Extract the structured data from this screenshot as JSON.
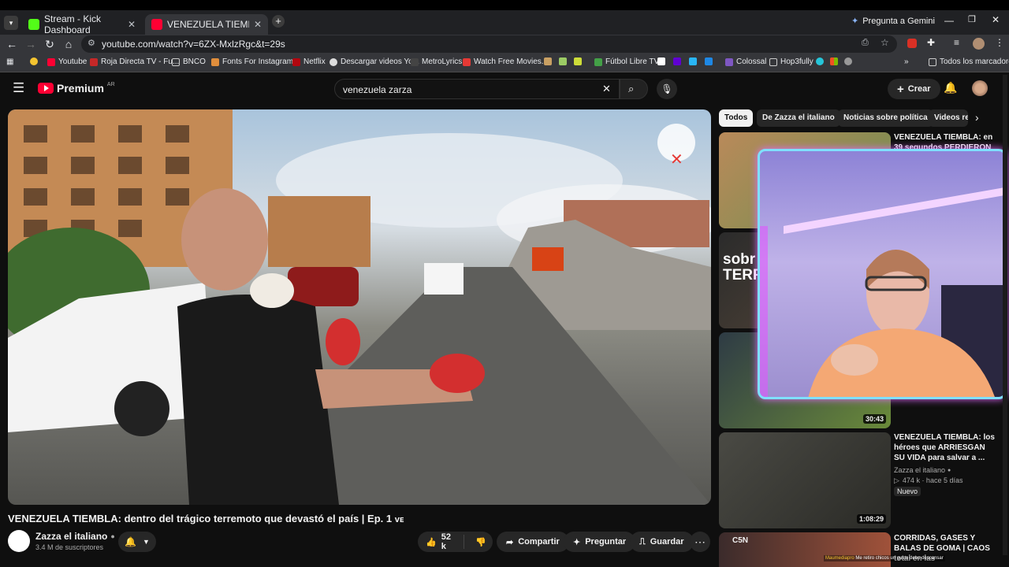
{
  "browser": {
    "tabs": [
      {
        "label": "Stream - Kick Dashboard",
        "close": "✕"
      },
      {
        "label": "VENEZUELA TIEMBLA: dentro d",
        "close": "✕"
      }
    ],
    "new_tab": "+",
    "gemini_label": "Pregunta a Gemini",
    "url": "youtube.com/watch?v=6ZX-MxlzRgc&t=29s",
    "bookmarks": [
      "Youtube",
      "Roja Directa TV - Fu...",
      "BNCO",
      "Fonts For Instagram...",
      "Netflix",
      "Descargar videos Yo...",
      "MetroLyrics",
      "Watch Free Movies...",
      "Fútbol Libre TV",
      "Colossal",
      "Hop3fully"
    ],
    "all_bookmarks": "Todos los marcadores",
    "overflow": "»"
  },
  "youtube": {
    "logo": "Premium",
    "region": "AR",
    "search_value": "venezuela zarza",
    "create_label": "Crear",
    "chips": [
      "Todos",
      "De Zazza el italiano",
      "Noticias sobre política",
      "Videos re"
    ],
    "video": {
      "title": "VENEZUELA TIEMBLA: dentro del trágico terremoto que devastó el país | Ep. 1",
      "channel": "Zazza el italiano",
      "subscribers": "3.4 M de suscriptores",
      "likes": "52 k",
      "share": "Compartir",
      "ask": "Preguntar",
      "save": "Guardar"
    },
    "related": [
      {
        "title": "VENEZUELA TIEMBLA: en 39 segundos PERDIERON",
        "duration": ""
      },
      {
        "title": "",
        "duration": ""
      },
      {
        "title": "",
        "duration": "30:43"
      },
      {
        "title": "VENEZUELA TIEMBLA: los héroes que ARRIESGAN SU VIDA para salvar a ...",
        "channel": "Zazza el italiano",
        "meta": "474 k · hace 5 días",
        "badge": "Nuevo",
        "duration": "1:08:29"
      },
      {
        "title": "CORRIDAS, GASES Y BALAS DE GOMA | CAOS total en las",
        "duration": ""
      }
    ],
    "thumb2_text": "sobr\nTERREM",
    "thumb5_text": "C5N",
    "chat_overlay": {
      "user": "Maumediapro",
      "message": "Me retiro chicos un gusto debo descansar"
    }
  },
  "colors": {
    "accent_red": "#ff0033",
    "bg": "#0f0f0f",
    "cam_border": "#7fe0ff"
  }
}
